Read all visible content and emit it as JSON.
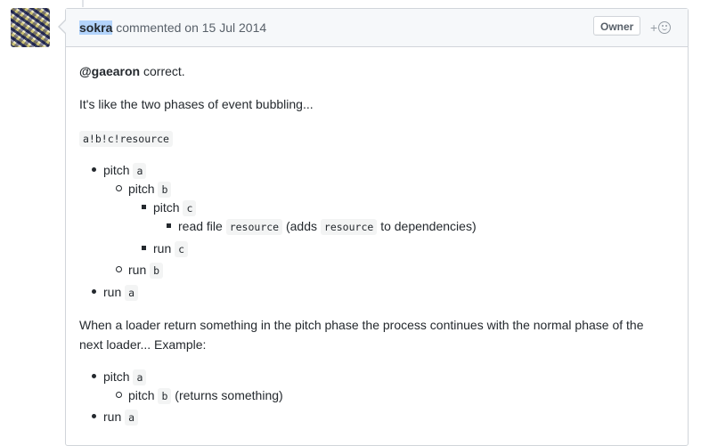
{
  "comment": {
    "author": "sokra",
    "action_text": "commented on 15 Jul 2014",
    "badge": "Owner",
    "reaction_plus": "+"
  },
  "body": {
    "p1_mention": "@gaearon",
    "p1_rest": " correct.",
    "p2": "It's like the two phases of event bubbling...",
    "code_line": "a!b!c!resource",
    "list1": [
      {
        "text": "pitch",
        "code": "a"
      },
      {
        "text": "pitch",
        "code": "b"
      },
      {
        "text": "pitch",
        "code": "c"
      },
      {
        "text_a": "read file",
        "code_a": "resource",
        "text_b": "(adds",
        "code_b": "resource",
        "text_c": "to dependencies)"
      },
      {
        "text": "run",
        "code": "c"
      },
      {
        "text": "run",
        "code": "b"
      },
      {
        "text": "run",
        "code": "a"
      }
    ],
    "p3_line1": "When a loader return something in the pitch phase the process continues with the normal phase of the",
    "p3_line2": "next loader... Example:",
    "list2": [
      {
        "text": "pitch",
        "code": "a"
      },
      {
        "text": "pitch",
        "code": "b",
        "suffix": "(returns something)"
      },
      {
        "text": "run",
        "code": "a"
      }
    ]
  }
}
